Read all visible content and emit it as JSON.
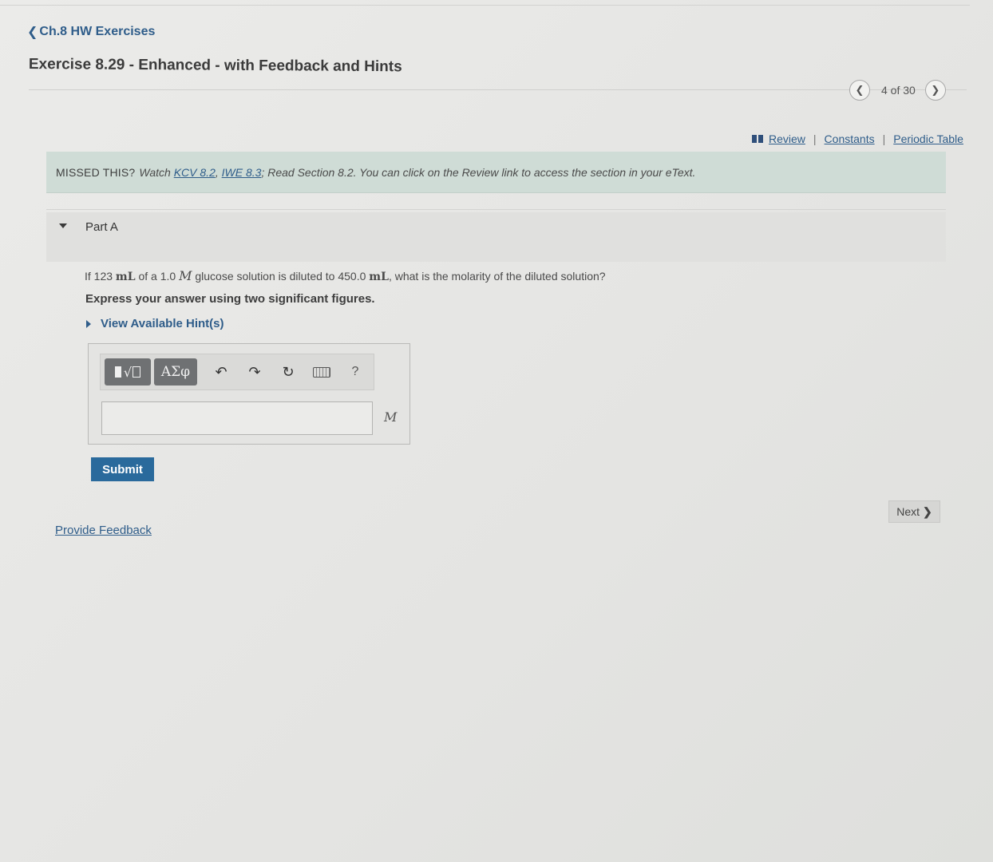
{
  "nav": {
    "back_label": "Ch.8 HW Exercises",
    "back_icon": "chevron-left-icon",
    "title": "Exercise 8.29 - Enhanced - with Feedback and Hints"
  },
  "pager": {
    "prev_icon": "chevron-left-icon",
    "next_icon": "chevron-right-icon",
    "count": "4 of 30"
  },
  "resources": {
    "icon": "book-icon",
    "review": "Review",
    "separator": "|",
    "constants": "Constants",
    "periodic_table": "Periodic Table"
  },
  "missed": {
    "label": "MISSED THIS?",
    "watch": "Watch",
    "kcv_link": "KCV 8.2",
    "comma": ",",
    "iwe_link": "IWE 8.3",
    "rest": "; Read Section 8.2. You can click on the Review link to access the section in your eText."
  },
  "part": {
    "label": "Part A",
    "q_1": "If 123",
    "q_unit_1": "mL",
    "q_2": "of a 1.0",
    "q_var": "M",
    "q_3": "glucose solution is diluted to 450.0",
    "q_unit_2": "mL",
    "q_4": ", what is the molarity of the diluted solution?",
    "instruction": "Express your answer using two significant figures.",
    "hints": "View Available Hint(s)"
  },
  "toolbar": {
    "templates_icon": "templates-radical-icon",
    "greek_label": "ΑΣφ",
    "undo_icon": "undo-icon",
    "redo_icon": "redo-icon",
    "reset_icon": "reset-icon",
    "keyboard_icon": "keyboard-icon",
    "help_label": "?"
  },
  "answer": {
    "value": "",
    "unit": "M"
  },
  "buttons": {
    "submit": "Submit",
    "next": "Next",
    "feedback": "Provide Feedback"
  },
  "colors": {
    "link": "#2f5d8a",
    "submit_bg": "#2a6a9c",
    "missed_bg": "#cfdcd6",
    "toolbar_dark": "#6f7173"
  }
}
